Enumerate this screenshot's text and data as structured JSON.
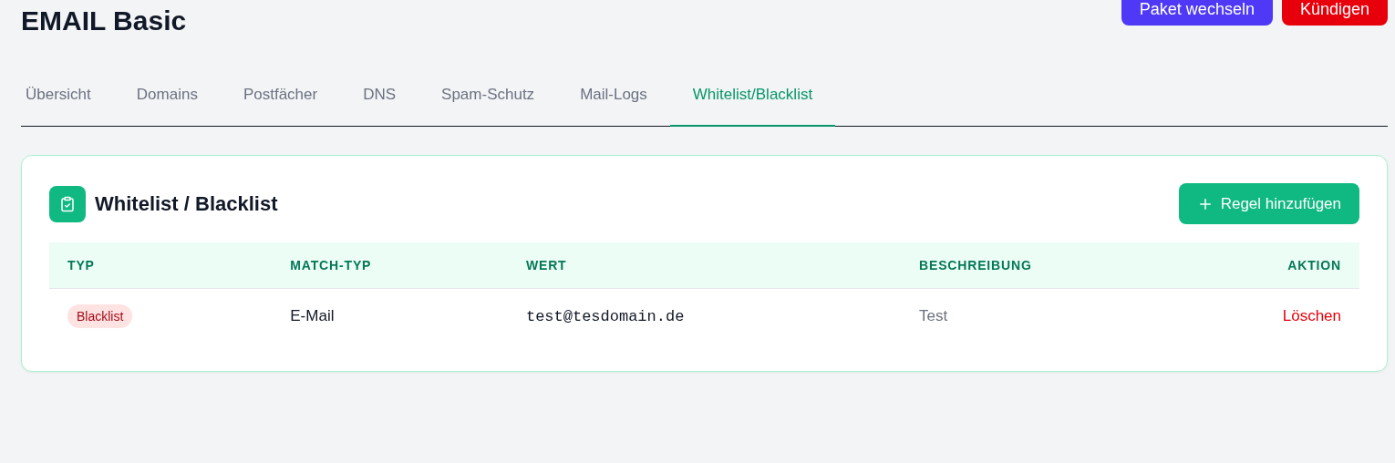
{
  "page": {
    "title": "EMAIL Basic",
    "actions": [
      {
        "label": "Paket wechseln",
        "kind": "primary"
      },
      {
        "label": "Kündigen",
        "kind": "danger"
      }
    ]
  },
  "tabs": [
    {
      "label": "Übersicht",
      "selected": false
    },
    {
      "label": "Domains",
      "selected": false
    },
    {
      "label": "Postfächer",
      "selected": false
    },
    {
      "label": "DNS",
      "selected": false
    },
    {
      "label": "Spam-Schutz",
      "selected": false
    },
    {
      "label": "Mail-Logs",
      "selected": false
    },
    {
      "label": "Whitelist/Blacklist",
      "selected": true
    }
  ],
  "card": {
    "title": "Whitelist / Blacklist",
    "add_button": "Regel hinzufügen",
    "table": {
      "columns": [
        "TYP",
        "MATCH-TYP",
        "WERT",
        "BESCHREIBUNG",
        "AKTION"
      ],
      "rows": [
        {
          "type": "Blacklist",
          "kind": "blacklist",
          "match_type": "E-Mail",
          "value": "test@tesdomain.de",
          "description": "Test",
          "action": "Löschen"
        }
      ]
    }
  }
}
